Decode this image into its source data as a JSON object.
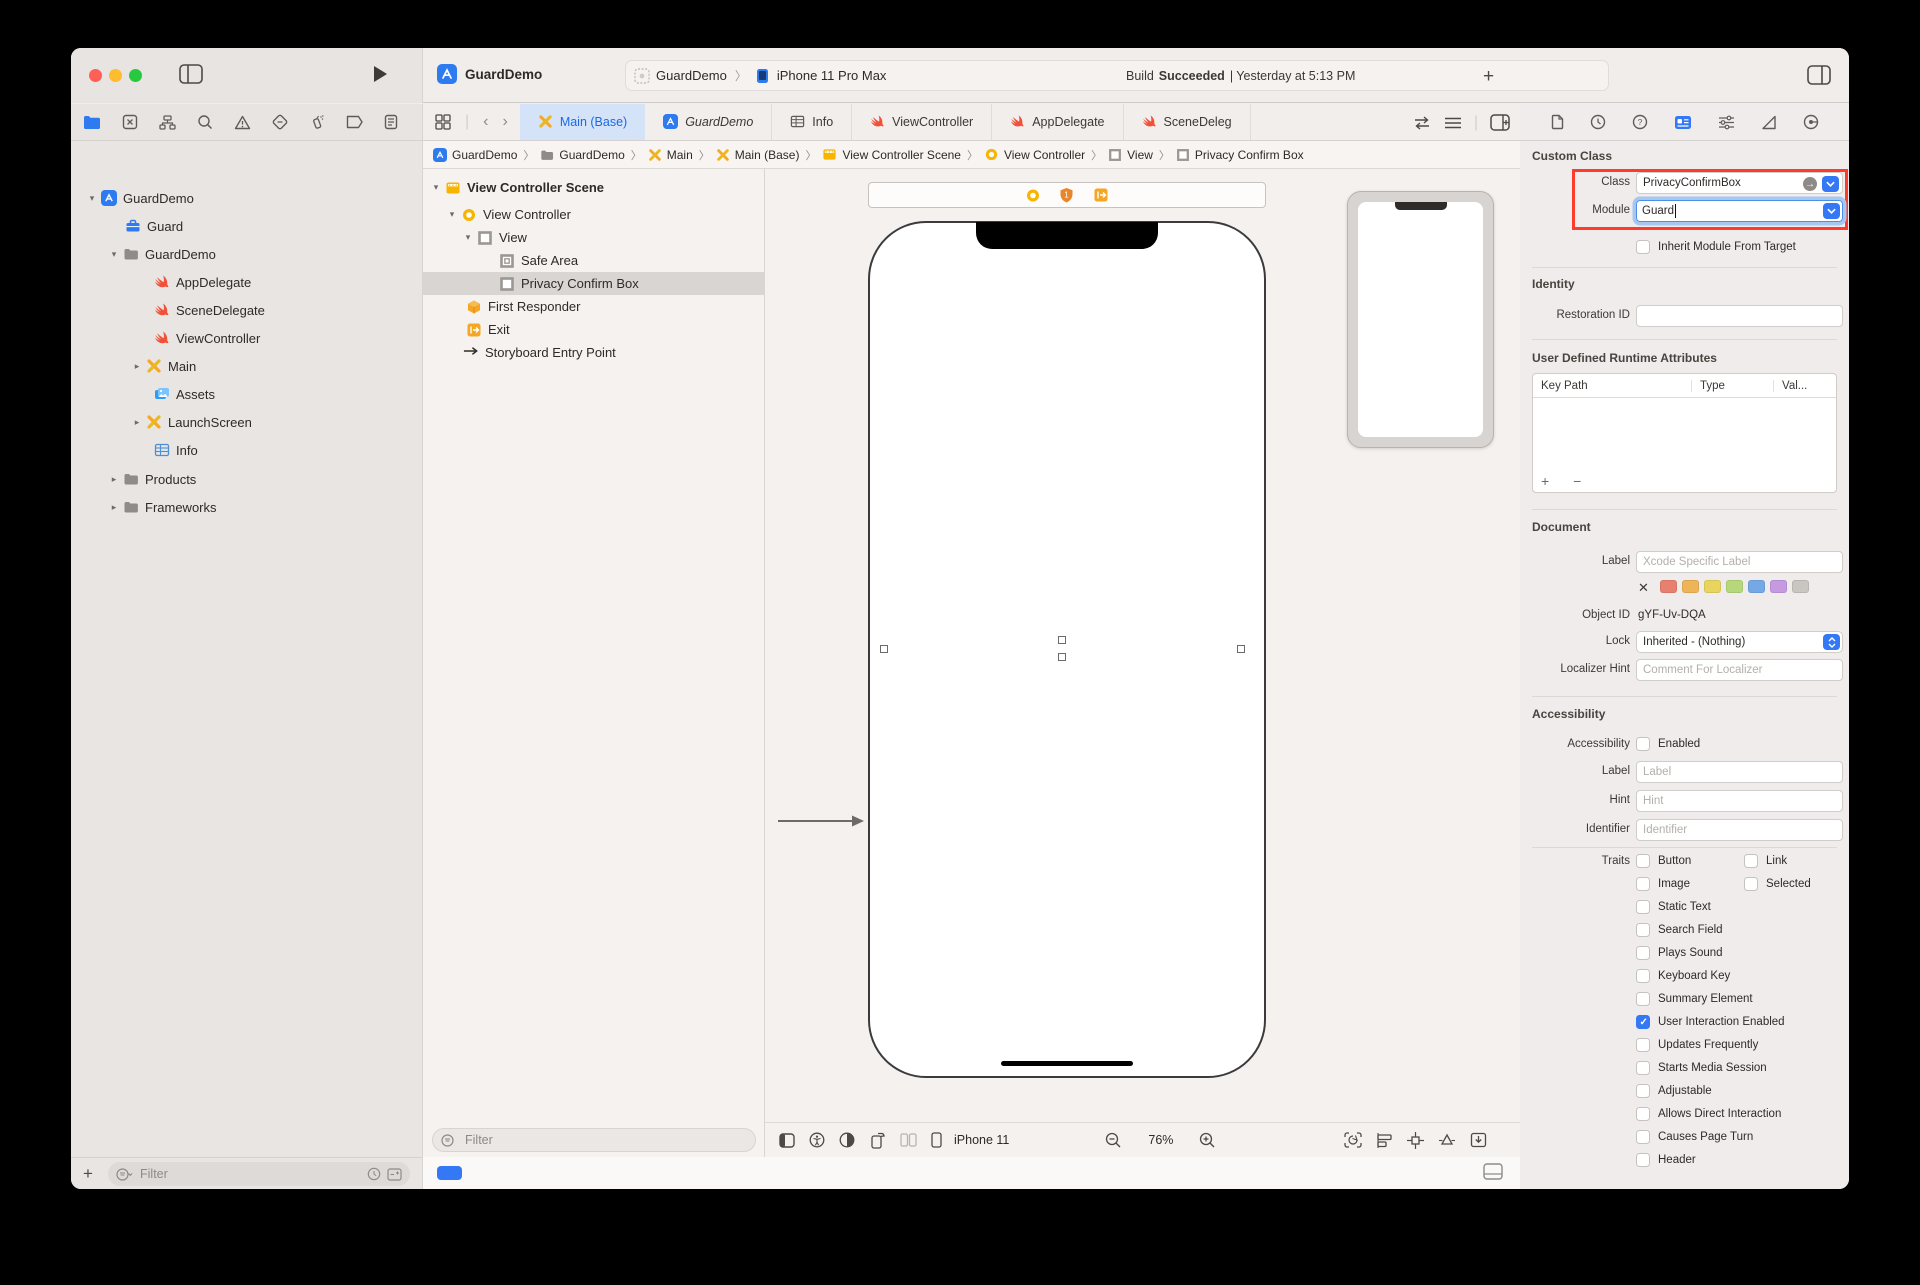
{
  "titlebar": {
    "app_title": "GuardDemo"
  },
  "toolbar": {
    "scheme_project": "GuardDemo",
    "scheme_device": "iPhone 11 Pro Max",
    "status_build": "Build",
    "status_result": "Succeeded",
    "status_time": "| Yesterday at 5:13 PM"
  },
  "navigator": {
    "items": [
      {
        "label": "GuardDemo"
      },
      {
        "label": "Guard"
      },
      {
        "label": "GuardDemo"
      },
      {
        "label": "AppDelegate"
      },
      {
        "label": "SceneDelegate"
      },
      {
        "label": "ViewController"
      },
      {
        "label": "Main"
      },
      {
        "label": "Assets"
      },
      {
        "label": "LaunchScreen"
      },
      {
        "label": "Info"
      },
      {
        "label": "Products"
      },
      {
        "label": "Frameworks"
      }
    ],
    "filter_placeholder": "Filter"
  },
  "tabs": {
    "items": [
      {
        "label": "Main (Base)"
      },
      {
        "label": "GuardDemo"
      },
      {
        "label": "Info"
      },
      {
        "label": "ViewController"
      },
      {
        "label": "AppDelegate"
      },
      {
        "label": "SceneDeleg"
      }
    ]
  },
  "breadcrumb": {
    "items": [
      {
        "label": "GuardDemo"
      },
      {
        "label": "GuardDemo"
      },
      {
        "label": "Main"
      },
      {
        "label": "Main (Base)"
      },
      {
        "label": "View Controller Scene"
      },
      {
        "label": "View Controller"
      },
      {
        "label": "View"
      },
      {
        "label": "Privacy Confirm Box"
      }
    ]
  },
  "outline": {
    "items": [
      {
        "label": "View Controller Scene"
      },
      {
        "label": "View Controller"
      },
      {
        "label": "View"
      },
      {
        "label": "Safe Area"
      },
      {
        "label": "Privacy Confirm Box"
      },
      {
        "label": "First Responder"
      },
      {
        "label": "Exit"
      },
      {
        "label": "Storyboard Entry Point"
      }
    ],
    "filter_placeholder": "Filter"
  },
  "canvas": {
    "device_label": "iPhone 11",
    "zoom_level": "76%"
  },
  "inspector": {
    "custom_class": {
      "header": "Custom Class",
      "class_label": "Class",
      "class_value": "PrivacyConfirmBox",
      "module_label": "Module",
      "module_value": "Guard",
      "inherit_label": "Inherit Module From Target"
    },
    "identity": {
      "header": "Identity",
      "restoration_label": "Restoration ID"
    },
    "runtime_attrs": {
      "header": "User Defined Runtime Attributes",
      "col_keypath": "Key Path",
      "col_type": "Type",
      "col_value": "Val...",
      "add_remove": "+ −"
    },
    "document": {
      "header": "Document",
      "label_label": "Label",
      "label_placeholder": "Xcode Specific Label",
      "object_id_label": "Object ID",
      "object_id_value": "gYF-Uv-DQA",
      "lock_label": "Lock",
      "lock_value": "Inherited - (Nothing)",
      "localizer_label": "Localizer Hint",
      "localizer_placeholder": "Comment For Localizer",
      "swatch_colors": [
        "#e8806f",
        "#edb458",
        "#e8d45e",
        "#b6d77a",
        "#74a9e6",
        "#c59ae0",
        "#c9c5c1"
      ]
    },
    "accessibility": {
      "header": "Accessibility",
      "acc_label": "Accessibility",
      "enabled_label": "Enabled",
      "label_label": "Label",
      "label_placeholder": "Label",
      "hint_label": "Hint",
      "hint_placeholder": "Hint",
      "identifier_label": "Identifier",
      "identifier_placeholder": "Identifier",
      "traits_label": "Traits",
      "traits": [
        {
          "label": "Button",
          "checked": false
        },
        {
          "label": "Link",
          "checked": false
        },
        {
          "label": "Image",
          "checked": false
        },
        {
          "label": "Selected",
          "checked": false
        },
        {
          "label": "Static Text",
          "checked": false
        },
        {
          "label": "Search Field",
          "checked": false
        },
        {
          "label": "Plays Sound",
          "checked": false
        },
        {
          "label": "Keyboard Key",
          "checked": false
        },
        {
          "label": "Summary Element",
          "checked": false
        },
        {
          "label": "User Interaction Enabled",
          "checked": true
        },
        {
          "label": "Updates Frequently",
          "checked": false
        },
        {
          "label": "Starts Media Session",
          "checked": false
        },
        {
          "label": "Adjustable",
          "checked": false
        },
        {
          "label": "Allows Direct Interaction",
          "checked": false
        },
        {
          "label": "Causes Page Turn",
          "checked": false
        },
        {
          "label": "Header",
          "checked": false
        }
      ]
    }
  },
  "colors": {
    "accent": "#3478f6",
    "annotation_red": "#ff3b30",
    "swift_orange": "#f05138",
    "storyboard_yellow": "#f7b500",
    "selected_tab_bg": "#d5e3f8"
  }
}
